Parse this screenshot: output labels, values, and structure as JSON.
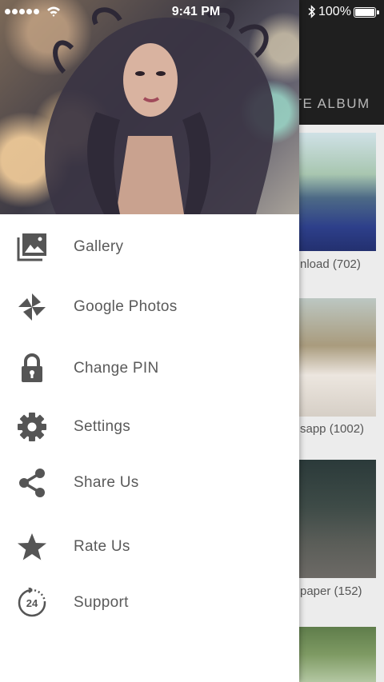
{
  "status_bar": {
    "time": "9:41 PM",
    "battery_percent": "100%",
    "signal_bars": 5
  },
  "background_screen": {
    "header_title_partial": "ATE ALBUM",
    "albums": [
      {
        "caption_partial": "nload (702)"
      },
      {
        "caption_partial": "sapp (1002)"
      },
      {
        "caption_partial": "paper (152)"
      }
    ]
  },
  "drawer": {
    "menu": [
      {
        "label": "Gallery",
        "icon": "gallery-icon"
      },
      {
        "label": "Google Photos",
        "icon": "pinwheel-icon"
      },
      {
        "label": "Change PIN",
        "icon": "lock-icon"
      },
      {
        "label": "Settings",
        "icon": "gear-icon"
      },
      {
        "label": "Share Us",
        "icon": "share-icon"
      },
      {
        "label": "Rate Us",
        "icon": "star-icon"
      },
      {
        "label": "Support",
        "icon": "support-24-icon",
        "icon_text": "24"
      }
    ]
  },
  "colors": {
    "menu_text": "#5a5a5a",
    "menu_icon": "#555555",
    "drawer_bg": "#ffffff",
    "header_bg": "#1f1f1f"
  }
}
